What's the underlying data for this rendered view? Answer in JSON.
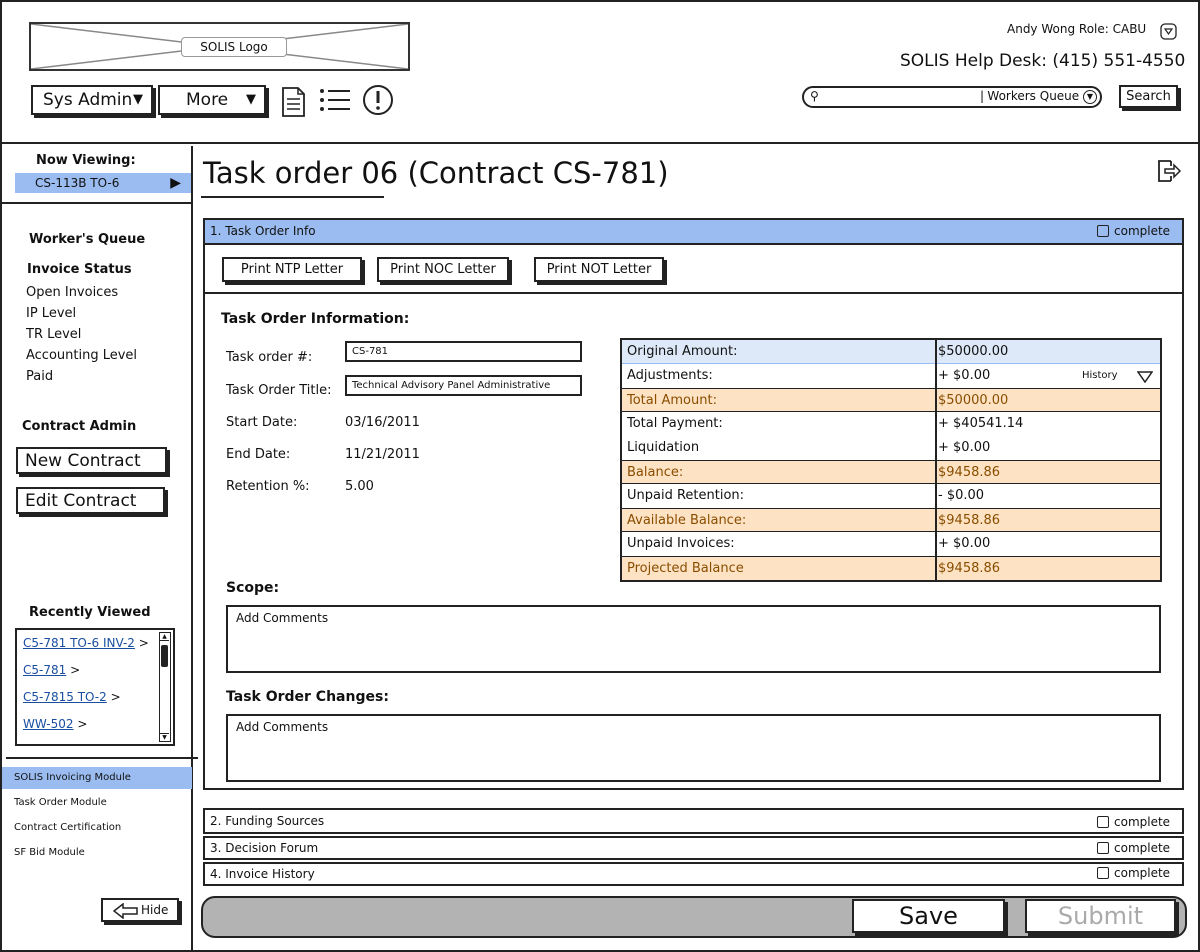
{
  "header": {
    "logo_text": "SOLIS Logo",
    "user_line": "Andy Wong  Role: CABU",
    "helpdesk": "SOLIS Help Desk: (415) 551-4550",
    "menu_sysadmin": "Sys Admin",
    "menu_more": "More",
    "search_scope": "Workers Queue",
    "search_button": "Search",
    "icons": [
      "document-icon",
      "list-icon",
      "alert-icon"
    ]
  },
  "sidebar": {
    "now_viewing_label": "Now Viewing:",
    "now_viewing_value": "CS-113B TO-6",
    "workers_queue": "Worker's Queue",
    "invoice_status": "Invoice Status",
    "invoice_items": [
      "Open Invoices",
      "IP Level",
      "TR Level",
      "Accounting Level",
      "Paid"
    ],
    "contract_admin": "Contract Admin",
    "new_contract": "New Contract",
    "edit_contract": "Edit Contract",
    "recently_viewed": "Recently Viewed",
    "recent_links": [
      "C5-781 TO-6 INV-2",
      "C5-781",
      "C5-7815 TO-2",
      "WW-502"
    ],
    "recent_suffix": ">",
    "modules": [
      "SOLIS Invoicing Module",
      "Task Order Module",
      "Contract Certification",
      "SF Bid Module"
    ],
    "hide_button": "Hide"
  },
  "main": {
    "title": "Task order 06 (Contract CS-781)",
    "section1": {
      "label": "1. Task Order Info",
      "complete_label": "complete"
    },
    "print_buttons": [
      "Print NTP Letter",
      "Print NOC Letter",
      "Print NOT Letter"
    ],
    "info_heading": "Task Order Information:",
    "fields": {
      "task_order_num_label": "Task order #:",
      "task_order_num_value": "CS-781",
      "title_label": "Task Order Title:",
      "title_value": "Technical Advisory Panel Administrative",
      "start_label": "Start Date:",
      "start_value": "03/16/2011",
      "end_label": "End Date:",
      "end_value": "11/21/2011",
      "retention_label": "Retention %:",
      "retention_value": "5.00"
    },
    "financials": [
      {
        "label": "Original Amount:",
        "value": "$50000.00"
      },
      {
        "label": "Adjustments:",
        "value": "+ $0.00"
      },
      {
        "label": "Total Amount:",
        "value": "$50000.00"
      },
      {
        "label": "Total Payment:",
        "value": "+ $40541.14"
      },
      {
        "label": "Liquidation",
        "value": "+ $0.00"
      },
      {
        "label": "Balance:",
        "value": "$9458.86"
      },
      {
        "label": "Unpaid Retention:",
        "value": "- $0.00"
      },
      {
        "label": "Available Balance:",
        "value": "$9458.86"
      },
      {
        "label": "Unpaid Invoices:",
        "value": "+ $0.00"
      },
      {
        "label": "Projected Balance",
        "value": "$9458.86"
      }
    ],
    "history_label": "History",
    "scope_heading": "Scope:",
    "scope_placeholder": "Add Comments",
    "changes_heading": "Task Order Changes:",
    "changes_placeholder": "Add Comments",
    "sections": [
      {
        "label": "2. Funding Sources",
        "complete_label": "complete"
      },
      {
        "label": "3. Decision Forum",
        "complete_label": "complete"
      },
      {
        "label": "4. Invoice History",
        "complete_label": "complete"
      }
    ],
    "save_button": "Save",
    "submit_button": "Submit"
  },
  "colors": {
    "accent_blue": "#9bbcf0",
    "highlight_row": "#fde3c4",
    "original_row": "#dde9f8",
    "highlight_text": "#8a4d00"
  }
}
